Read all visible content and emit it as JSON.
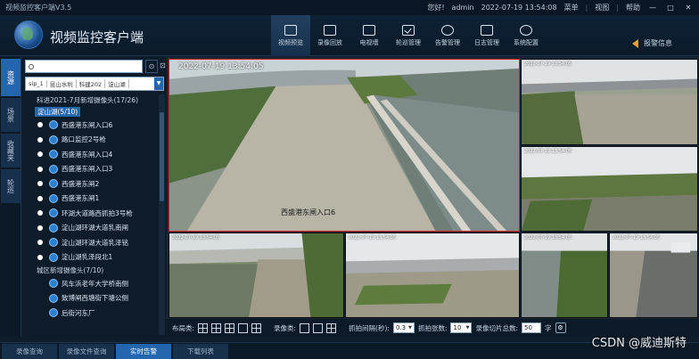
{
  "window": {
    "title": "视频监控客户端V3.5",
    "greeting": "您好!",
    "user": "admin",
    "datetime": "2022-07-19 13:54:08",
    "menu_label": "菜单",
    "view_label": "视图",
    "help_label": "帮助",
    "min_glyph": "—",
    "max_glyph": "□",
    "close_glyph": "✕"
  },
  "header": {
    "app_name": "视频监控客户端",
    "nav": [
      {
        "label": "视频预览",
        "icon": "video-preview-icon"
      },
      {
        "label": "录像回放",
        "icon": "playback-icon"
      },
      {
        "label": "电视墙",
        "icon": "tv-wall-icon"
      },
      {
        "label": "轮巡管理",
        "icon": "patrol-icon"
      },
      {
        "label": "告警管理",
        "icon": "alarm-icon"
      },
      {
        "label": "日志管理",
        "icon": "log-icon"
      },
      {
        "label": "系统配置",
        "icon": "settings-icon"
      }
    ],
    "alarm_info": "报警信息"
  },
  "sidebar_tabs": [
    "资源",
    "场景",
    "收藏夹",
    "轮巡"
  ],
  "search": {
    "placeholder": "",
    "btn": "⊙",
    "btn2": "⊡"
  },
  "filters": [
    "sip_1",
    "昆山水利",
    "科建202",
    "淀山湖"
  ],
  "tree": {
    "group1": "科进2021-7月新增摄像头(17/26)",
    "sub1": "淀山湖(5/10)",
    "cameras": [
      "西盛港东闸入口6",
      "路口监控2号枪",
      "西盛港东闸入口4",
      "西盛港东闸入口3",
      "西盛港东闸2",
      "西盛港东闸1",
      "环湖大道路西抓拍3号枪",
      "淀山湖环湖大道乳南闸",
      "淀山湖环湖大道乳泽铭",
      "淀山湖乳泽段北1"
    ],
    "group2": "城区新增摄像头(7/10)",
    "cameras2": [
      "风车浜老年大学桥南侧",
      "致博闸西塘街下塘公侧",
      "后街河东厂"
    ]
  },
  "video": {
    "main_osd": "2022-07-19 13:54:05",
    "main_label": "西盛港东闸入口6",
    "small_osd": "2022-07-19 13:54:05"
  },
  "toolbar": {
    "layout_label": "布局类:",
    "record_label": "录像类:",
    "capture_interval_label": "抓拍间隔(秒):",
    "capture_interval": "0.3",
    "capture_count_label": "抓拍张数:",
    "capture_count": "10",
    "clip_count_label": "录像切片总数:",
    "clip_count": "50",
    "clip_suffix": "字"
  },
  "bottom_tabs": [
    "录像查询",
    "录像文件查询",
    "实时告警",
    "下载列表"
  ],
  "active_bottom_tab": 2,
  "watermark": "CSDN @威迪斯特",
  "colors": {
    "accent": "#2466ad",
    "selected_border": "#d02020"
  }
}
